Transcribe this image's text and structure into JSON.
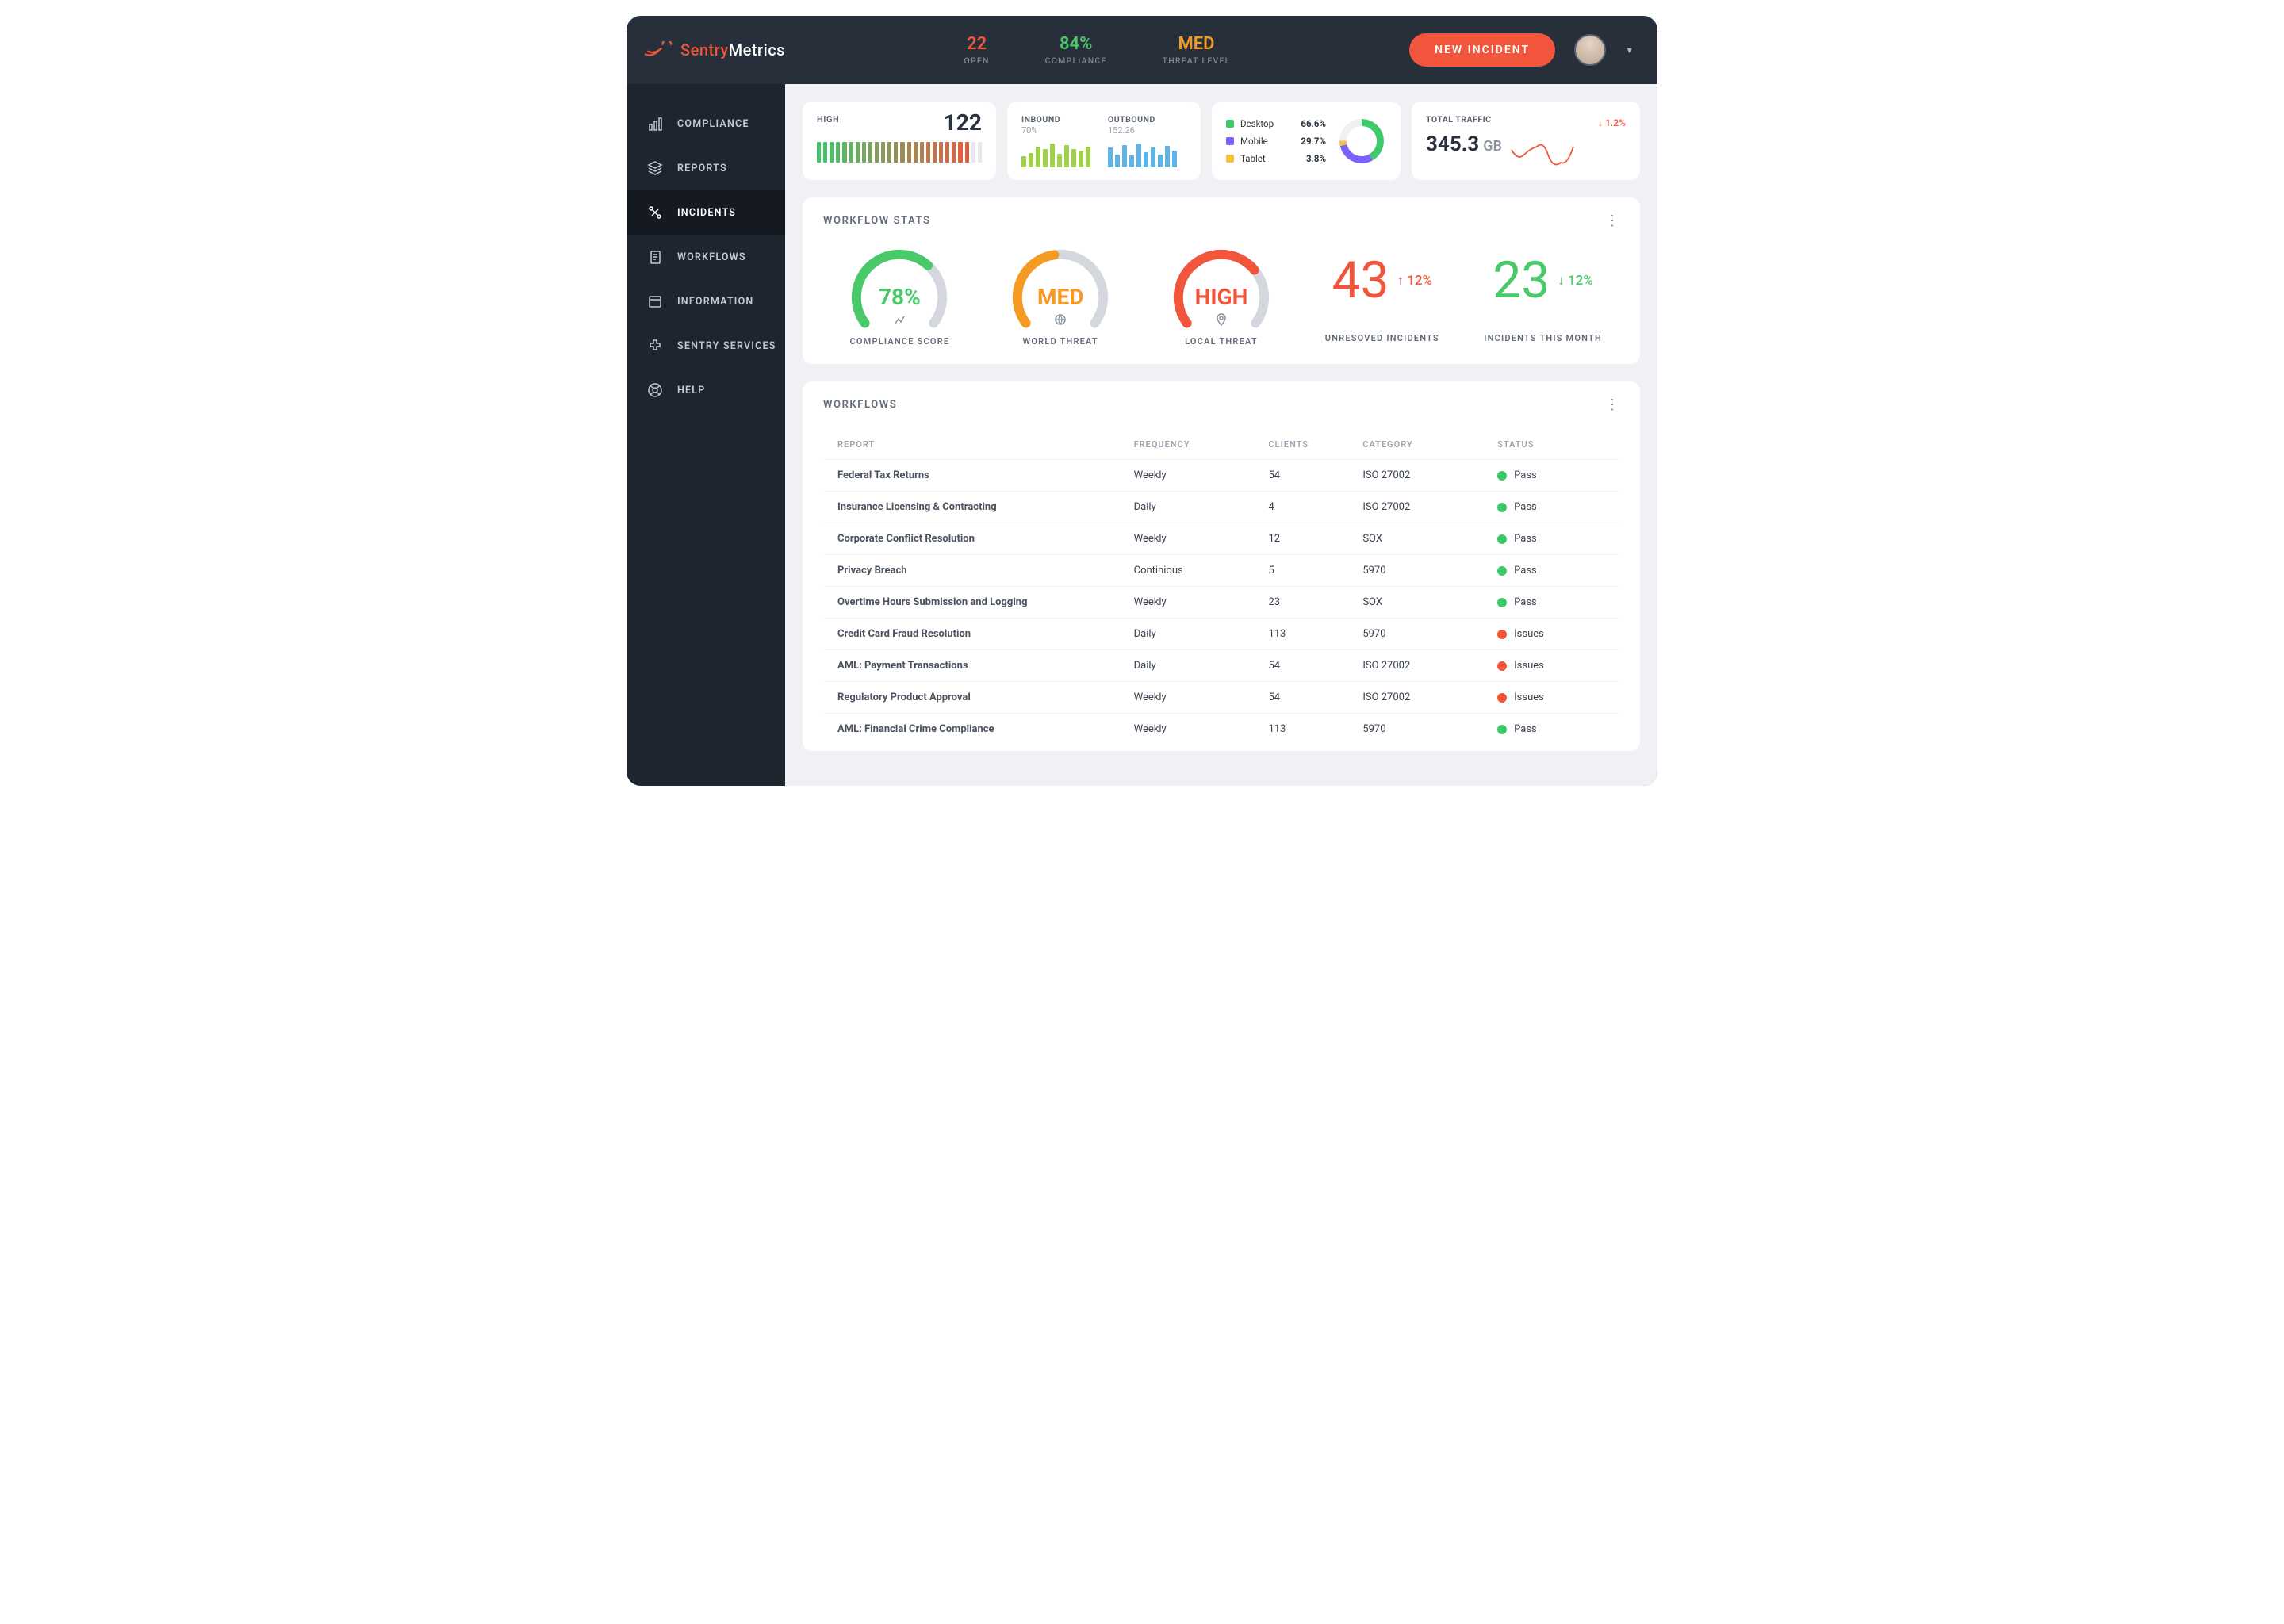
{
  "brand": {
    "name_accent": "Sentry",
    "name_rest": "Metrics"
  },
  "header": {
    "stats": {
      "open": {
        "value": "22",
        "label": "OPEN",
        "color": "#f1553b"
      },
      "compliance": {
        "value": "84%",
        "label": "COMPLIANCE",
        "color": "#4ac96b"
      },
      "threat": {
        "value": "MED",
        "label": "THREAT LEVEL",
        "color": "#f59a23"
      }
    },
    "new_incident_label": "NEW INCIDENT"
  },
  "sidebar": {
    "items": [
      {
        "label": "COMPLIANCE",
        "icon": "chart-bar-icon"
      },
      {
        "label": "REPORTS",
        "icon": "layers-icon"
      },
      {
        "label": "INCIDENTS",
        "icon": "tools-icon",
        "active": true
      },
      {
        "label": "WORKFLOWS",
        "icon": "clipboard-icon"
      },
      {
        "label": "INFORMATION",
        "icon": "browser-icon"
      },
      {
        "label": "SENTRY SERVICES",
        "icon": "puzzle-icon"
      },
      {
        "label": "HELP",
        "icon": "lifebuoy-icon"
      }
    ]
  },
  "cards": {
    "high": {
      "label": "HIGH",
      "value": "122"
    },
    "inbound": {
      "label": "INBOUND",
      "value": "70%"
    },
    "outbound": {
      "label": "OUTBOUND",
      "value": "152.26"
    },
    "devices": {
      "items": [
        {
          "name": "Desktop",
          "pct": "66.6%",
          "color": "#3fc96b"
        },
        {
          "name": "Mobile",
          "pct": "29.7%",
          "color": "#7b61ff"
        },
        {
          "name": "Tablet",
          "pct": "3.8%",
          "color": "#f5c23e"
        }
      ]
    },
    "traffic": {
      "label": "TOTAL TRAFFIC",
      "value": "345.3",
      "unit": "GB",
      "delta": "1.2%"
    }
  },
  "workflow_stats": {
    "title": "WORKFLOW STATS",
    "gauges": {
      "compliance": {
        "value": "78%",
        "label": "COMPLIANCE SCORE",
        "color": "#4ac96b",
        "fill": 0.78
      },
      "world": {
        "value": "MED",
        "label": "WORLD THREAT",
        "color": "#f59a23",
        "fill": 0.55
      },
      "local": {
        "value": "HIGH",
        "label": "LOCAL THREAT",
        "color": "#f1553b",
        "fill": 0.82
      }
    },
    "counters": {
      "unresolved": {
        "value": "43",
        "delta": "12%",
        "dir": "up",
        "label": "UNRESOVED INCIDENTS",
        "color": "#f1553b"
      },
      "month": {
        "value": "23",
        "delta": "12%",
        "dir": "down",
        "label": "INCIDENTS THIS MONTH",
        "color": "#4ac96b"
      }
    }
  },
  "workflows": {
    "title": "WORKFLOWS",
    "columns": {
      "report": "REPORT",
      "frequency": "FREQUENCY",
      "clients": "CLIENTS",
      "category": "CATEGORY",
      "status": "STATUS"
    },
    "rows": [
      {
        "report": "Federal Tax Returns",
        "frequency": "Weekly",
        "clients": "54",
        "category": "ISO 27002",
        "status": "Pass",
        "status_color": "#3fc96b"
      },
      {
        "report": "Insurance Licensing & Contracting",
        "frequency": "Daily",
        "clients": "4",
        "category": "ISO 27002",
        "status": "Pass",
        "status_color": "#3fc96b"
      },
      {
        "report": "Corporate Conflict Resolution",
        "frequency": "Weekly",
        "clients": "12",
        "category": "SOX",
        "status": "Pass",
        "status_color": "#3fc96b"
      },
      {
        "report": "Privacy Breach",
        "frequency": "Continious",
        "clients": "5",
        "category": "5970",
        "status": "Pass",
        "status_color": "#3fc96b"
      },
      {
        "report": "Overtime Hours Submission and Logging",
        "frequency": "Weekly",
        "clients": "23",
        "category": "SOX",
        "status": "Pass",
        "status_color": "#3fc96b"
      },
      {
        "report": "Credit Card Fraud Resolution",
        "frequency": "Daily",
        "clients": "113",
        "category": "5970",
        "status": "Issues",
        "status_color": "#f1553b"
      },
      {
        "report": "AML: Payment Transactions",
        "frequency": "Daily",
        "clients": "54",
        "category": "ISO 27002",
        "status": "Issues",
        "status_color": "#f1553b"
      },
      {
        "report": "Regulatory Product Approval",
        "frequency": "Weekly",
        "clients": "54",
        "category": "ISO 27002",
        "status": "Issues",
        "status_color": "#f1553b"
      },
      {
        "report": "AML: Financial Crime Compliance",
        "frequency": "Weekly",
        "clients": "113",
        "category": "5970",
        "status": "Pass",
        "status_color": "#3fc96b"
      }
    ]
  },
  "chart_data": [
    {
      "type": "bar",
      "title": "HIGH severity heat bars",
      "values": [
        1,
        1,
        1,
        1,
        1,
        1,
        1,
        1,
        1,
        1,
        1,
        1,
        1,
        1,
        1,
        1,
        1,
        1,
        1,
        1,
        1,
        1,
        1,
        1,
        0.25,
        0.25
      ],
      "colors_gradient": [
        "#3fc96b",
        "#f1553b"
      ]
    },
    {
      "type": "bar",
      "title": "INBOUND",
      "values": [
        9,
        13,
        22,
        18,
        26,
        12,
        24,
        18,
        16,
        22
      ],
      "color": "#9fd24a"
    },
    {
      "type": "bar",
      "title": "OUTBOUND",
      "values": [
        22,
        12,
        26,
        10,
        28,
        15,
        22,
        12,
        24,
        18
      ],
      "color": "#5fb4e6"
    },
    {
      "type": "pie",
      "title": "Device share",
      "series": [
        {
          "name": "Desktop",
          "value": 66.6
        },
        {
          "name": "Mobile",
          "value": 29.7
        },
        {
          "name": "Tablet",
          "value": 3.8
        }
      ]
    },
    {
      "type": "line",
      "title": "TOTAL TRAFFIC sparkline",
      "values": [
        20,
        10,
        16,
        28,
        14,
        24,
        10,
        30,
        26
      ],
      "color": "#f1553b"
    }
  ]
}
